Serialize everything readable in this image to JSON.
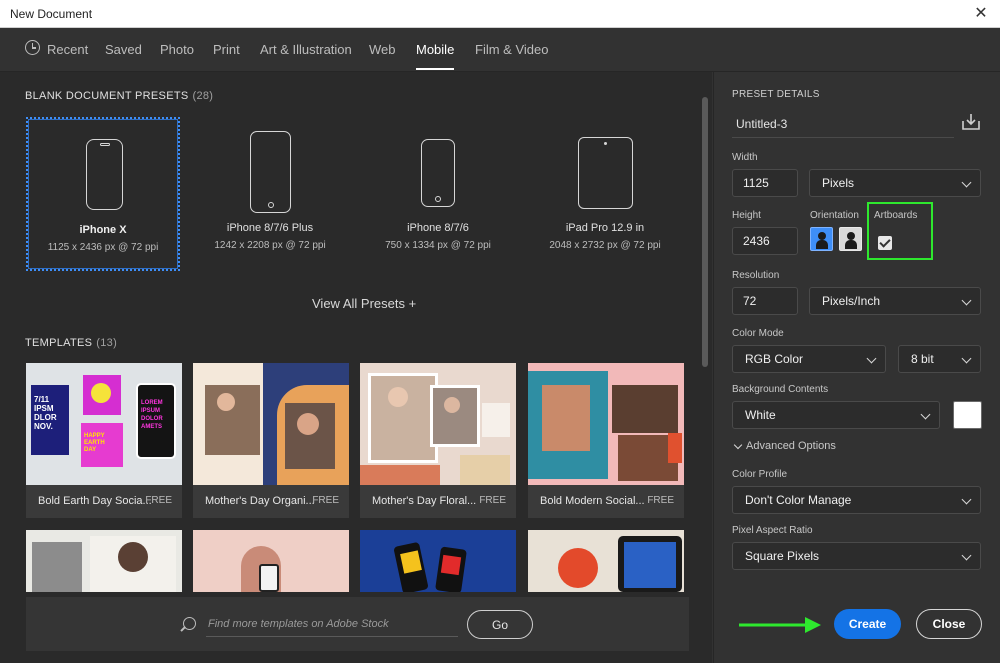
{
  "window": {
    "title": "New Document",
    "close_glyph": "✕"
  },
  "tabs": [
    {
      "label": "Recent",
      "active": false
    },
    {
      "label": "Saved",
      "active": false
    },
    {
      "label": "Photo",
      "active": false
    },
    {
      "label": "Print",
      "active": false
    },
    {
      "label": "Art & Illustration",
      "active": false
    },
    {
      "label": "Web",
      "active": false
    },
    {
      "label": "Mobile",
      "active": true
    },
    {
      "label": "Film & Video",
      "active": false
    }
  ],
  "presets": {
    "title": "BLANK DOCUMENT PRESETS",
    "count": "(28)",
    "items": [
      {
        "name": "iPhone X",
        "dims": "1125 x 2436 px @ 72 ppi",
        "selected": true
      },
      {
        "name": "iPhone 8/7/6 Plus",
        "dims": "1242 x 2208 px @ 72 ppi",
        "selected": false
      },
      {
        "name": "iPhone 8/7/6",
        "dims": "750 x 1334 px @ 72 ppi",
        "selected": false
      },
      {
        "name": "iPad Pro 12.9 in",
        "dims": "2048 x 2732 px @ 72 ppi",
        "selected": false
      }
    ],
    "view_all": "View All Presets +"
  },
  "templates": {
    "title": "TEMPLATES",
    "count": "(13)",
    "items": [
      {
        "caption": "Bold Earth Day Socia...",
        "badge": "FREE"
      },
      {
        "caption": "Mother's Day Organi...",
        "badge": "FREE"
      },
      {
        "caption": "Mother's Day Floral...",
        "badge": "FREE"
      },
      {
        "caption": "Bold Modern Social...",
        "badge": "FREE"
      }
    ],
    "thumb_text": {
      "earth_panel": "7/11\nIPSM\nDLOR\nNOV.",
      "earth_happy": "HAPPY\nEARTH\nDAY",
      "earth_lorem": "LOREM\nIPSUM\nDOLOR\nAMETS"
    }
  },
  "search": {
    "placeholder": "Find more templates on Adobe Stock",
    "value": "",
    "go_label": "Go"
  },
  "details": {
    "section_title": "PRESET DETAILS",
    "doc_name": "Untitled-3",
    "width_label": "Width",
    "width_value": "1125",
    "width_unit": "Pixels",
    "height_label": "Height",
    "height_value": "2436",
    "orientation_label": "Orientation",
    "artboards_label": "Artboards",
    "artboards_checked": true,
    "resolution_label": "Resolution",
    "resolution_value": "72",
    "resolution_unit": "Pixels/Inch",
    "color_mode_label": "Color Mode",
    "color_mode": "RGB Color",
    "bit_depth": "8 bit",
    "bg_label": "Background Contents",
    "bg_value": "White",
    "bg_swatch_color": "#ffffff",
    "advanced_label": "Advanced Options",
    "profile_label": "Color Profile",
    "profile_value": "Don't Color Manage",
    "pixel_ratio_label": "Pixel Aspect Ratio",
    "pixel_ratio_value": "Square Pixels"
  },
  "actions": {
    "create_label": "Create",
    "close_label": "Close"
  },
  "colors": {
    "accent": "#1473e6",
    "highlight_green": "#2ee82e",
    "selection_blue": "#3e8ef7"
  }
}
